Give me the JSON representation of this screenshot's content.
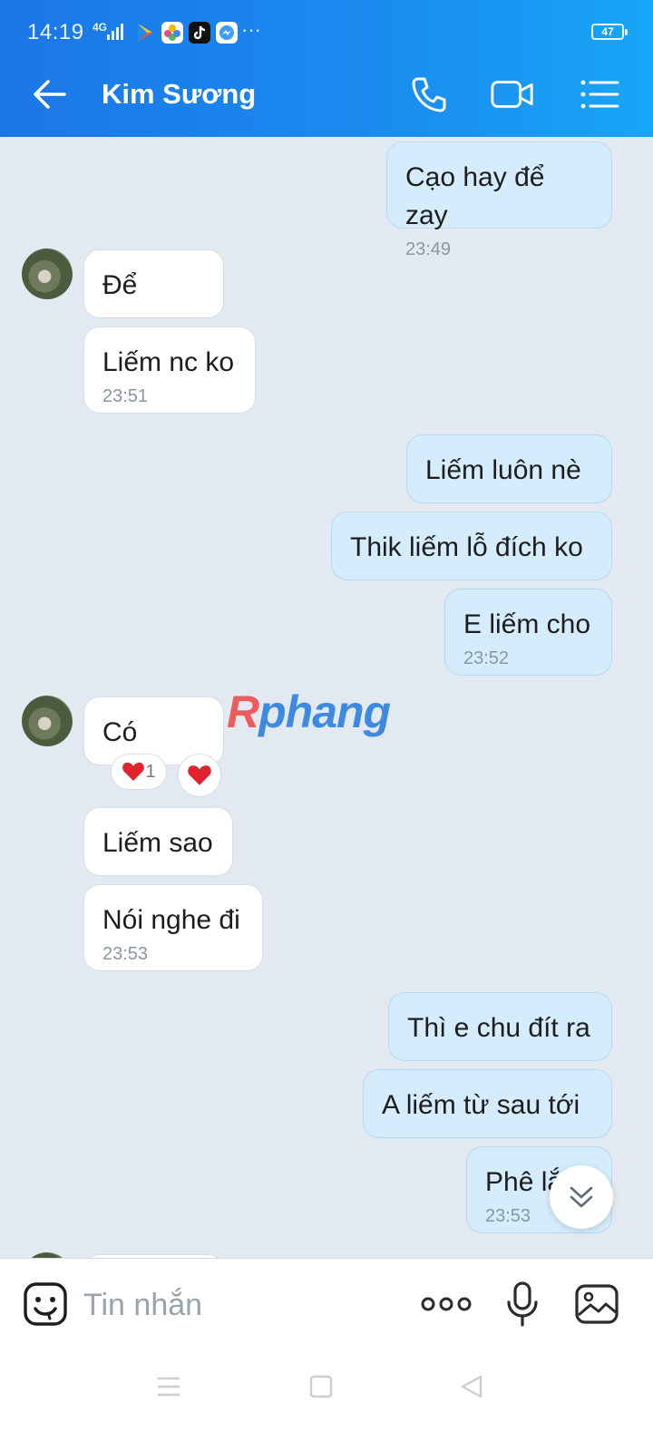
{
  "status_bar": {
    "time": "14:19",
    "network": "4G",
    "battery": "47",
    "overflow": "···"
  },
  "header": {
    "contact_name": "Kim Sương",
    "icons": [
      "back-arrow-icon",
      "phone-icon",
      "video-camera-icon",
      "menu-list-icon"
    ]
  },
  "messages": [
    {
      "dir": "out",
      "text": "Cạo hay để zay",
      "time": "23:49"
    },
    {
      "dir": "in",
      "text": "Để",
      "time": ""
    },
    {
      "dir": "in",
      "text": "Liếm nc ko",
      "time": "23:51"
    },
    {
      "dir": "out",
      "text": "Liếm luôn nè",
      "time": ""
    },
    {
      "dir": "out",
      "text": "Thik liếm lỗ đích ko",
      "time": ""
    },
    {
      "dir": "out",
      "text": "E liếm cho",
      "time": "23:52"
    },
    {
      "dir": "in",
      "text": "Có",
      "time": "",
      "reaction_count": "1"
    },
    {
      "dir": "in",
      "text": "Liếm sao",
      "time": ""
    },
    {
      "dir": "in",
      "text": "Nói nghe đi",
      "time": "23:53"
    },
    {
      "dir": "out",
      "text": "Thì e chu đít ra",
      "time": ""
    },
    {
      "dir": "out",
      "text": "A liếm từ sau tới",
      "time": ""
    },
    {
      "dir": "out",
      "text": "Phê lắ",
      "time": "23:53"
    }
  ],
  "watermark": {
    "part1": "R",
    "part2": "phang"
  },
  "input": {
    "placeholder": "Tin nhắn",
    "icons": [
      "sticker-emoji-icon",
      "more-dots-icon",
      "microphone-icon",
      "image-icon"
    ]
  },
  "colors": {
    "header": "#1a8cf0",
    "chat_background": "#e2e9f1",
    "outgoing_bubble": "#d4ecfc",
    "incoming_bubble": "#ffffff",
    "reaction_heart": "#e0242f"
  }
}
